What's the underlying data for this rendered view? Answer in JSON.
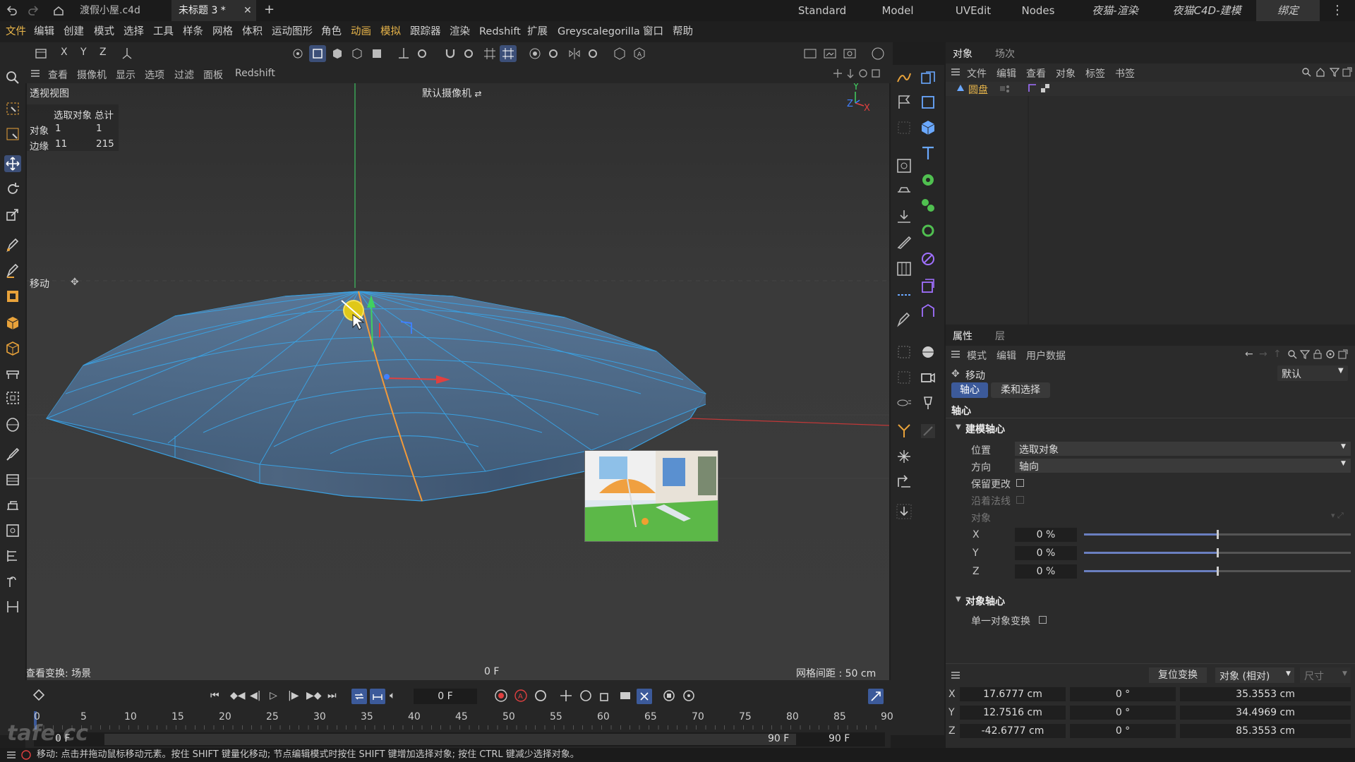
{
  "titlebar": {
    "tabs": [
      {
        "label": "渡假小屋.c4d",
        "active": false
      },
      {
        "label": "未标题 3 *",
        "active": true
      }
    ],
    "new_tab": "+",
    "layouts": [
      "Standard",
      "Model",
      "UVEdit",
      "Nodes",
      "夜猫-渲染",
      "夜猫C4D-建模",
      "绑定"
    ],
    "active_layout": "绑定"
  },
  "menubar": {
    "items": [
      "文件",
      "编辑",
      "创建",
      "模式",
      "选择",
      "工具",
      "样条",
      "网格",
      "体积",
      "运动图形",
      "角色",
      "动画",
      "模拟",
      "跟踪器",
      "渲染",
      "Redshift",
      "扩展",
      "Greyscalegorilla",
      "窗口",
      "帮助"
    ],
    "highlighted": [
      "文件",
      "动画",
      "模拟"
    ]
  },
  "toolbar": {
    "axes": [
      "X",
      "Y",
      "Z"
    ]
  },
  "viewport_menu": [
    "查看",
    "摄像机",
    "显示",
    "选项",
    "过滤",
    "面板",
    "Redshift"
  ],
  "viewport": {
    "name": "透视视图",
    "camera": "默认摄像机",
    "camera_icon": "camera-link-icon",
    "stats_header": [
      "选取对象",
      "总计"
    ],
    "stats": [
      {
        "label": "对象",
        "selected": "1",
        "total": "1"
      },
      {
        "label": "边缘",
        "selected": "11",
        "total": "215"
      }
    ],
    "tool_hint": "移动",
    "footer_left": "查看变换: 场景",
    "footer_center": "0 F",
    "footer_right": "网格间距 : 50 cm",
    "axis_labels": [
      "Y",
      "Z",
      "X"
    ]
  },
  "timeline": {
    "current_frame": "0 F",
    "ruler": [
      "0",
      "5",
      "10",
      "15",
      "20",
      "25",
      "30",
      "35",
      "40",
      "45",
      "50",
      "55",
      "60",
      "65",
      "70",
      "75",
      "80",
      "85",
      "90"
    ],
    "start_frame": "0 F",
    "preview_start": "0 F",
    "preview_end": "90 F",
    "end_frame": "90 F"
  },
  "object_panel": {
    "tabs": [
      "对象",
      "场次"
    ],
    "menu": [
      "文件",
      "编辑",
      "查看",
      "对象",
      "标签",
      "书签"
    ],
    "objects": [
      {
        "name": "圆盘"
      }
    ]
  },
  "attr_panel": {
    "tabs": [
      "属性",
      "层"
    ],
    "menu": [
      "模式",
      "编辑",
      "用户数据"
    ],
    "tool_name": "移动",
    "preset": "默认",
    "subtabs": [
      "轴心",
      "柔和选择"
    ],
    "active_subtab": "轴心",
    "section_title": "轴心",
    "group1": "建模轴心",
    "position_label": "位置",
    "position_value": "选取对象",
    "direction_label": "方向",
    "direction_value": "轴向",
    "keep_changes": "保留更改",
    "along_normal": "沿着法线",
    "object_label": "对象",
    "axes": [
      {
        "label": "X",
        "value": "0 %",
        "fraction": 0.5
      },
      {
        "label": "Y",
        "value": "0 %",
        "fraction": 0.5
      },
      {
        "label": "Z",
        "value": "0 %",
        "fraction": 0.5
      }
    ],
    "group2": "对象轴心",
    "single_object": "单一对象变换"
  },
  "coord_panel": {
    "reset": "复位变换",
    "mode": "对象 (相对)",
    "size": "尺寸",
    "rows": [
      {
        "axis": "X",
        "pos": "17.6777 cm",
        "rot": "0 °",
        "size": "35.3553 cm"
      },
      {
        "axis": "Y",
        "pos": "12.7516 cm",
        "rot": "0 °",
        "size": "34.4969 cm"
      },
      {
        "axis": "Z",
        "pos": "-42.6777 cm",
        "rot": "0 °",
        "size": "85.3553 cm"
      }
    ]
  },
  "statusbar": {
    "text": "移动: 点击并拖动鼠标移动元素。按住 SHIFT 键量化移动; 节点编辑模式时按住 SHIFT 键增加选择对象; 按住 CTRL 键减少选择对象。",
    "watermark": "tafe.cc"
  },
  "colors": {
    "accent": "#3c5a9a",
    "axis_x": "#e04040",
    "axis_y": "#40d060",
    "axis_z": "#4080ff",
    "mesh_fill": "#3e5772",
    "mesh_edge": "#3aa0e0",
    "selected_edge": "#f29a3a"
  }
}
